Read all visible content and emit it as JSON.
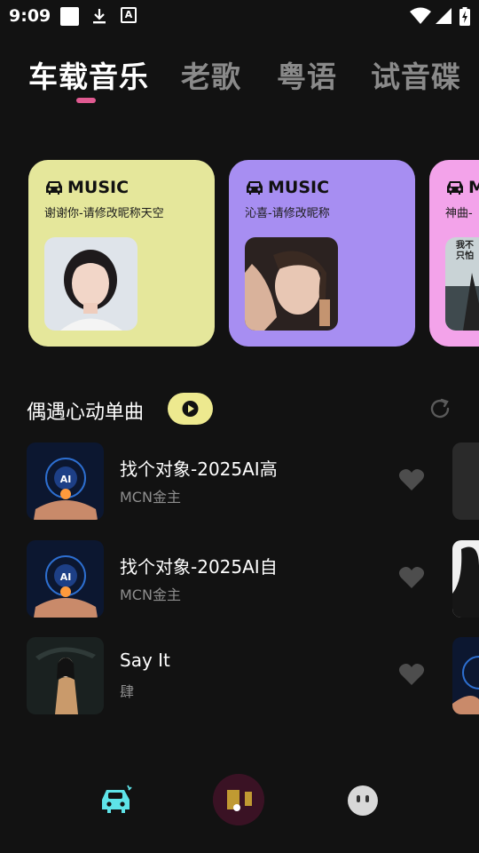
{
  "status_bar": {
    "time": "9:09",
    "a_icon_glyph": "A"
  },
  "tabs": [
    {
      "label": "车载音乐",
      "active": true
    },
    {
      "label": "老歌",
      "active": false
    },
    {
      "label": "粤语",
      "active": false
    },
    {
      "label": "试音碟",
      "active": false
    }
  ],
  "cards": [
    {
      "brand": "MUSIC",
      "subtitle": "谢谢你-请修改昵称天空",
      "color": "#e5e79b"
    },
    {
      "brand": "MUSIC",
      "subtitle": "沁喜-请修改昵称",
      "color": "#a78ef2"
    },
    {
      "brand": "MUSIC",
      "subtitle": "神曲-",
      "color": "#f3a3ea",
      "image_text": "我不 只怕"
    }
  ],
  "section": {
    "title": "偶遇心动单曲"
  },
  "songs": [
    {
      "title": "找个对象-2025AI高",
      "artist": "MCN金主"
    },
    {
      "title": "找个对象-2025AI自",
      "artist": "MCN金主"
    },
    {
      "title": "Say It",
      "artist": "肆"
    }
  ],
  "colors": {
    "accent": "#e05a91",
    "play_pill": "#ede98f",
    "nav_car": "#5ee3e8"
  },
  "icons": [
    "car-icon",
    "play-icon",
    "refresh-icon",
    "heart-icon",
    "face-icon"
  ]
}
